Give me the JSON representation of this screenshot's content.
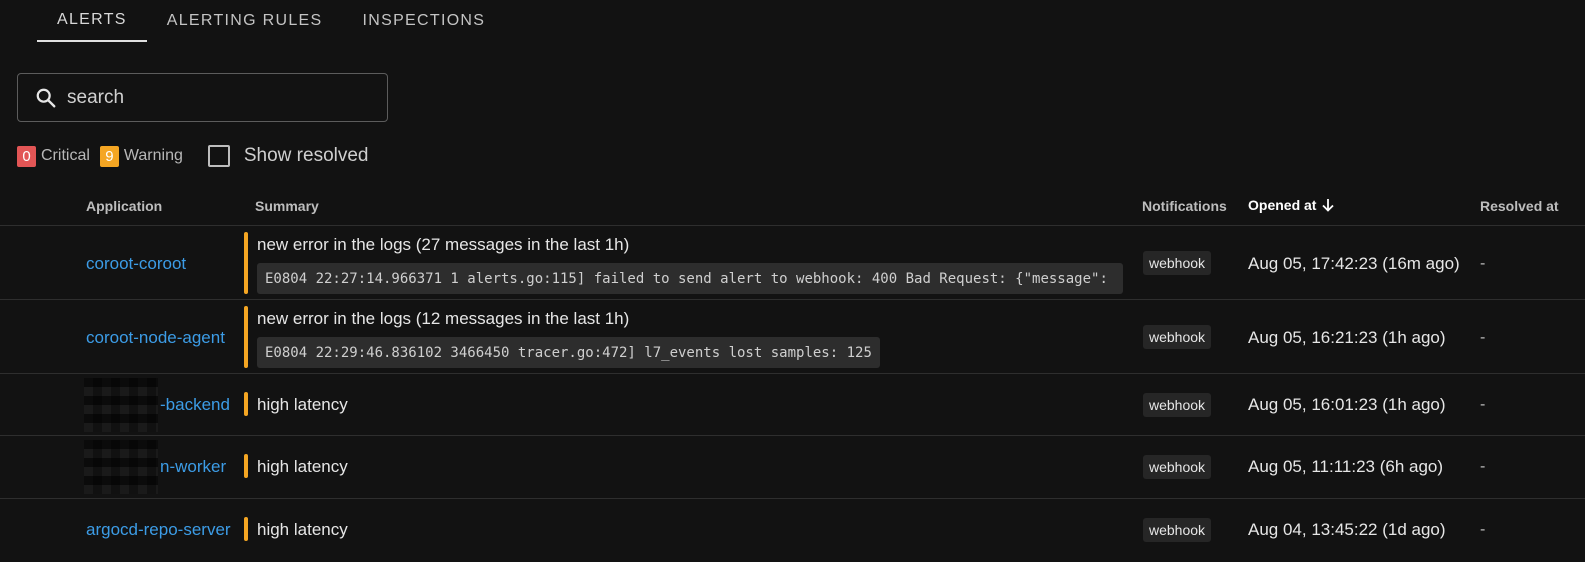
{
  "tabs": [
    {
      "label": "ALERTS",
      "active": true
    },
    {
      "label": "ALERTING RULES",
      "active": false
    },
    {
      "label": "INSPECTIONS",
      "active": false
    }
  ],
  "search": {
    "placeholder": "search",
    "value": ""
  },
  "filters": {
    "critical": {
      "count": "0",
      "label": "Critical"
    },
    "warning": {
      "count": "9",
      "label": "Warning"
    },
    "show_resolved": {
      "label": "Show resolved",
      "checked": false
    }
  },
  "table": {
    "headers": {
      "application": "Application",
      "summary": "Summary",
      "notifications": "Notifications",
      "opened_at": "Opened at",
      "resolved_at": "Resolved at"
    },
    "rows": [
      {
        "application": "coroot-coroot",
        "summary": "new error in the logs (27 messages in the last 1h)",
        "log": "E0804 22:27:14.966371 1 alerts.go:115] failed to send alert to webhook: 400 Bad Request: {\"message\":",
        "notification": "webhook",
        "opened_at": "Aug 05, 17:42:23 (16m ago)",
        "resolved_at": "-"
      },
      {
        "application": "coroot-node-agent",
        "summary": "new error in the logs (12 messages in the last 1h)",
        "log": "E0804 22:29:46.836102 3466450 tracer.go:472] l7_events lost samples: 125",
        "notification": "webhook",
        "opened_at": "Aug 05, 16:21:23 (1h ago)",
        "resolved_at": "-"
      },
      {
        "application": "-backend",
        "summary": "high latency",
        "notification": "webhook",
        "opened_at": "Aug 05, 16:01:23 (1h ago)",
        "resolved_at": "-"
      },
      {
        "application": "n-worker",
        "summary": "high latency",
        "notification": "webhook",
        "opened_at": "Aug 05, 11:11:23 (6h ago)",
        "resolved_at": "-"
      },
      {
        "application": "argocd-repo-server",
        "summary": "high latency",
        "notification": "webhook",
        "opened_at": "Aug 04, 13:45:22 (1d ago)",
        "resolved_at": "-"
      }
    ]
  },
  "colors": {
    "background": "#121212",
    "link": "#3c9ce6",
    "critical": "#e25555",
    "warning": "#f5a623"
  }
}
